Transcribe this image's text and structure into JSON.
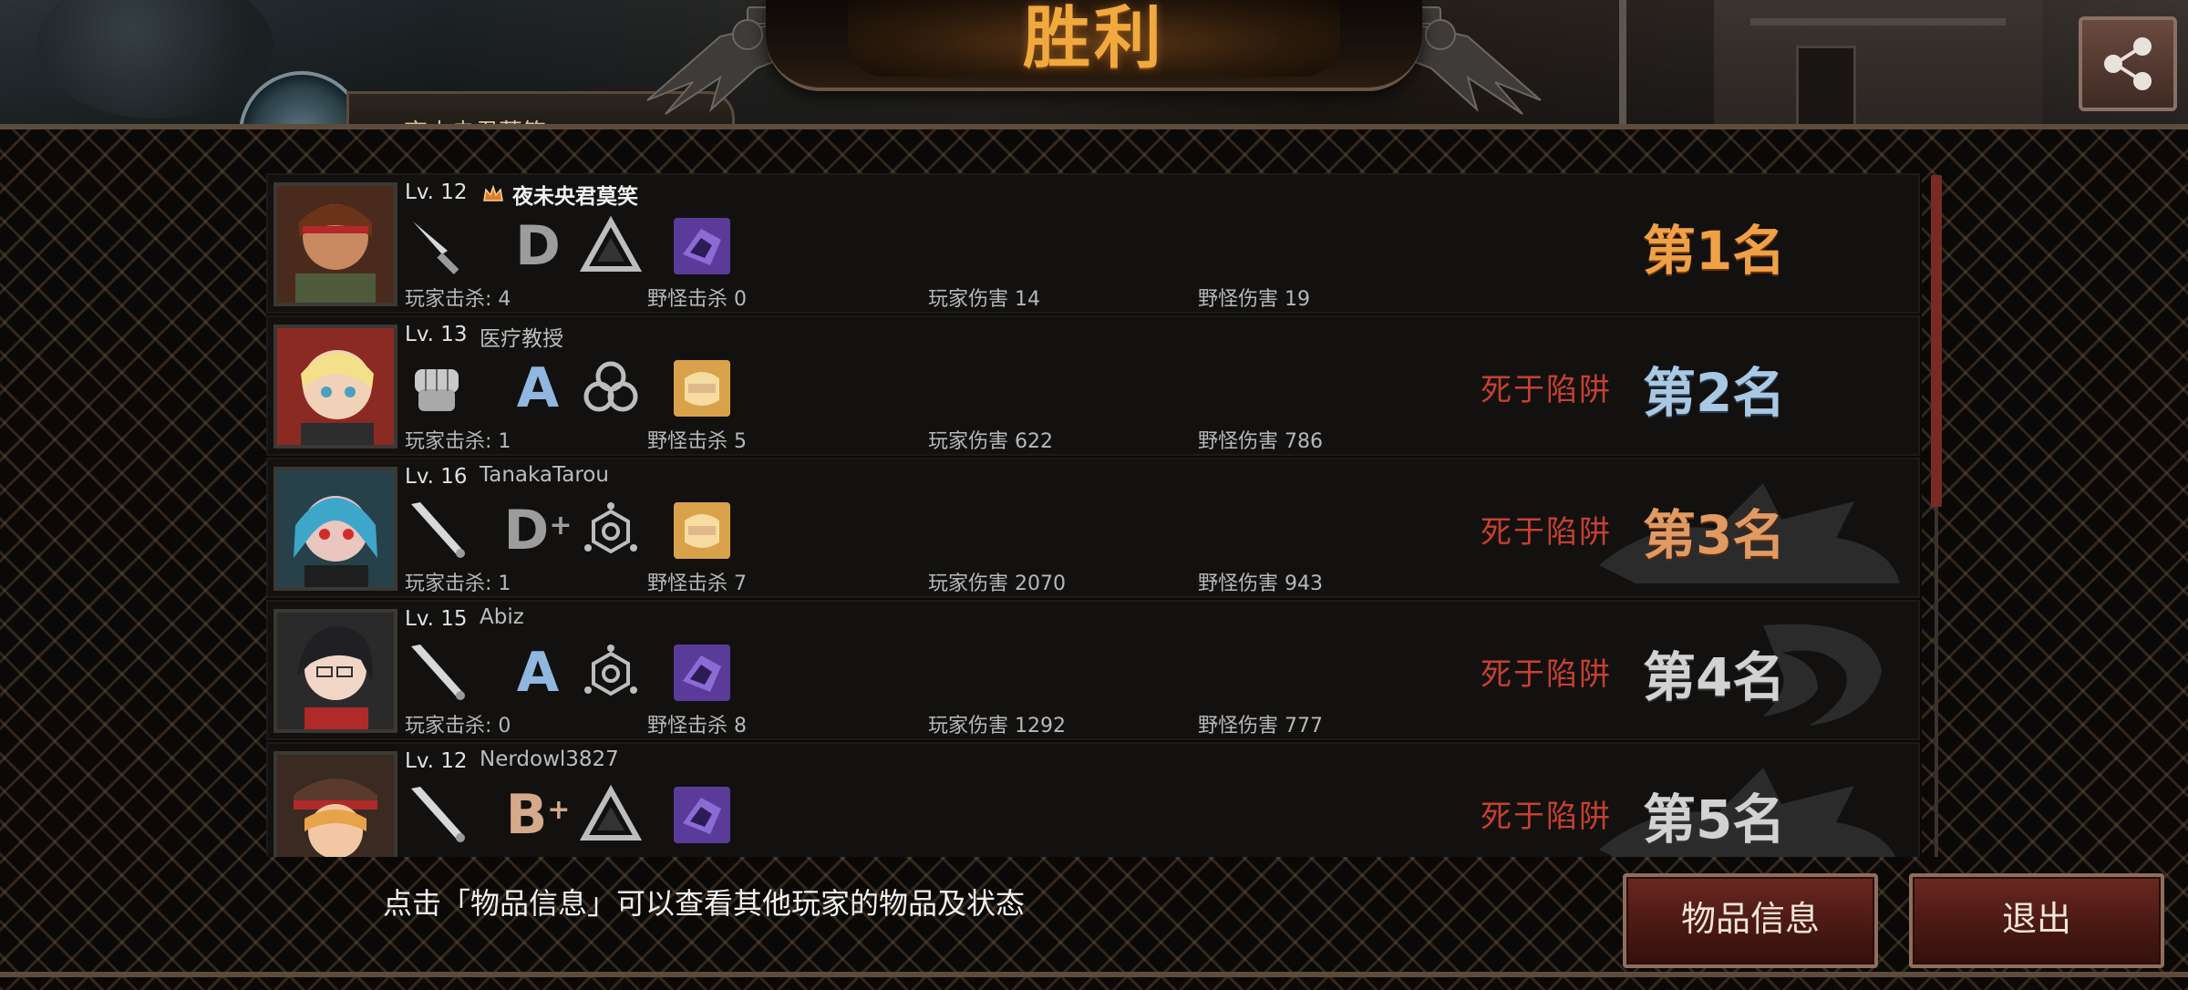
{
  "header": {
    "title": "胜利",
    "share_icon": "share-icon"
  },
  "self_player": {
    "name": "夜未央君莫笑"
  },
  "players": [
    {
      "level": "Lv. 12",
      "name": "夜未央君莫笑",
      "has_crown": true,
      "weapon_icon": "knife-icon",
      "grade": "D",
      "grade_plus": "",
      "trait_icon": "triangle-icon",
      "item_icon": "purple-item-icon",
      "stats": {
        "player_kills": "玩家击杀: 4",
        "monster_kills": "野怪击杀 0",
        "player_damage": "玩家伤害 14",
        "monster_damage": "野怪伤害 19"
      },
      "death": "",
      "rank": "第1名"
    },
    {
      "level": "Lv. 13",
      "name": "医疗教授",
      "has_crown": false,
      "weapon_icon": "fist-icon",
      "grade": "A",
      "grade_plus": "",
      "trait_icon": "triple-ring-icon",
      "item_icon": "gold-item-icon",
      "stats": {
        "player_kills": "玩家击杀: 1",
        "monster_kills": "野怪击杀 5",
        "player_damage": "玩家伤害 622",
        "monster_damage": "野怪伤害 786"
      },
      "death": "死于陷阱",
      "rank": "第2名"
    },
    {
      "level": "Lv. 16",
      "name": "TanakaTarou",
      "has_crown": false,
      "weapon_icon": "bat-icon",
      "grade": "D",
      "grade_plus": "+",
      "trait_icon": "hexagon-icon",
      "item_icon": "gold-item-icon",
      "stats": {
        "player_kills": "玩家击杀: 1",
        "monster_kills": "野怪击杀 7",
        "player_damage": "玩家伤害 2070",
        "monster_damage": "野怪伤害 943"
      },
      "death": "死于陷阱",
      "rank": "第3名"
    },
    {
      "level": "Lv. 15",
      "name": "Abiz",
      "has_crown": false,
      "weapon_icon": "bat-icon",
      "grade": "A",
      "grade_plus": "",
      "trait_icon": "hexagon-icon",
      "item_icon": "purple-item-icon",
      "stats": {
        "player_kills": "玩家击杀: 0",
        "monster_kills": "野怪击杀 8",
        "player_damage": "玩家伤害 1292",
        "monster_damage": "野怪伤害 777"
      },
      "death": "死于陷阱",
      "rank": "第4名"
    },
    {
      "level": "Lv. 12",
      "name": "Nerdowl3827",
      "has_crown": false,
      "weapon_icon": "bat-icon",
      "grade": "B",
      "grade_plus": "+",
      "trait_icon": "triangle-icon",
      "item_icon": "purple-item-icon",
      "stats": {
        "player_kills": "",
        "monster_kills": "",
        "player_damage": "",
        "monster_damage": ""
      },
      "death": "死于陷阱",
      "rank": "第5名"
    }
  ],
  "footer": {
    "hint": "点击「物品信息」可以查看其他玩家的物品及状态",
    "items_button": "物品信息",
    "exit_button": "退出"
  },
  "colors": {
    "title": "#f0a93e",
    "death": "#c8402e",
    "button": "#4a1913"
  }
}
